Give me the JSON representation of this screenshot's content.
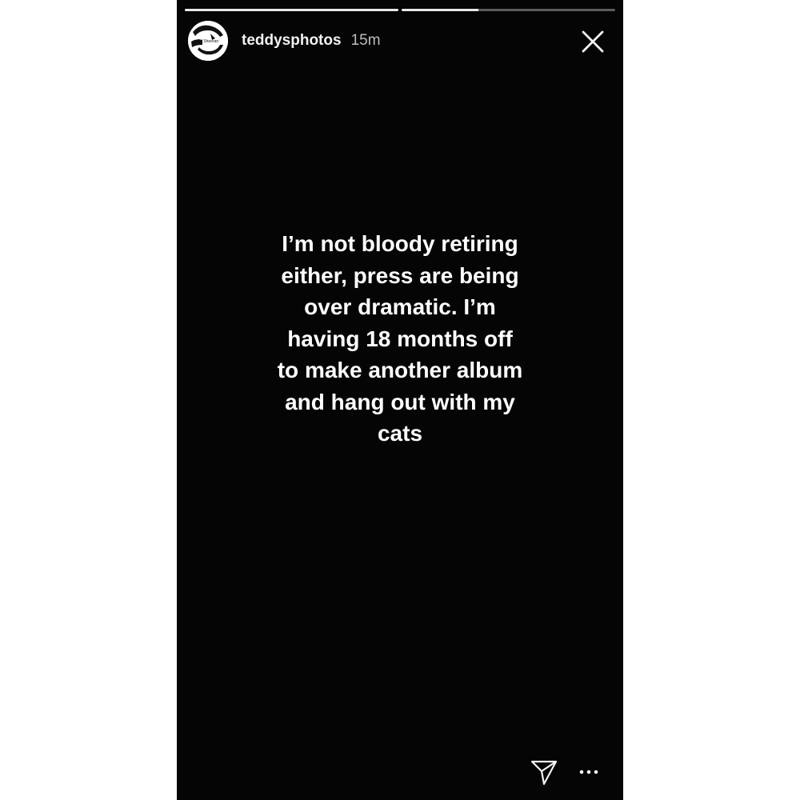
{
  "story": {
    "progress": [
      1.0,
      0.36
    ],
    "user": {
      "username": "teddysphotos",
      "time_ago": "15m",
      "avatar_icon": "avatar-logo",
      "avatar_text": "Ed Sheeran"
    },
    "text_lines": [
      "I’m not bloody retiring",
      "either, press are being",
      "over dramatic. I’m",
      "having 18 months off",
      "to make another album",
      "and hang out with my",
      "cats"
    ],
    "icons": {
      "close": "close-icon",
      "send": "send-icon",
      "more": "more-options-icon"
    },
    "colors": {
      "background": "#050505",
      "text": "#ffffff"
    }
  }
}
